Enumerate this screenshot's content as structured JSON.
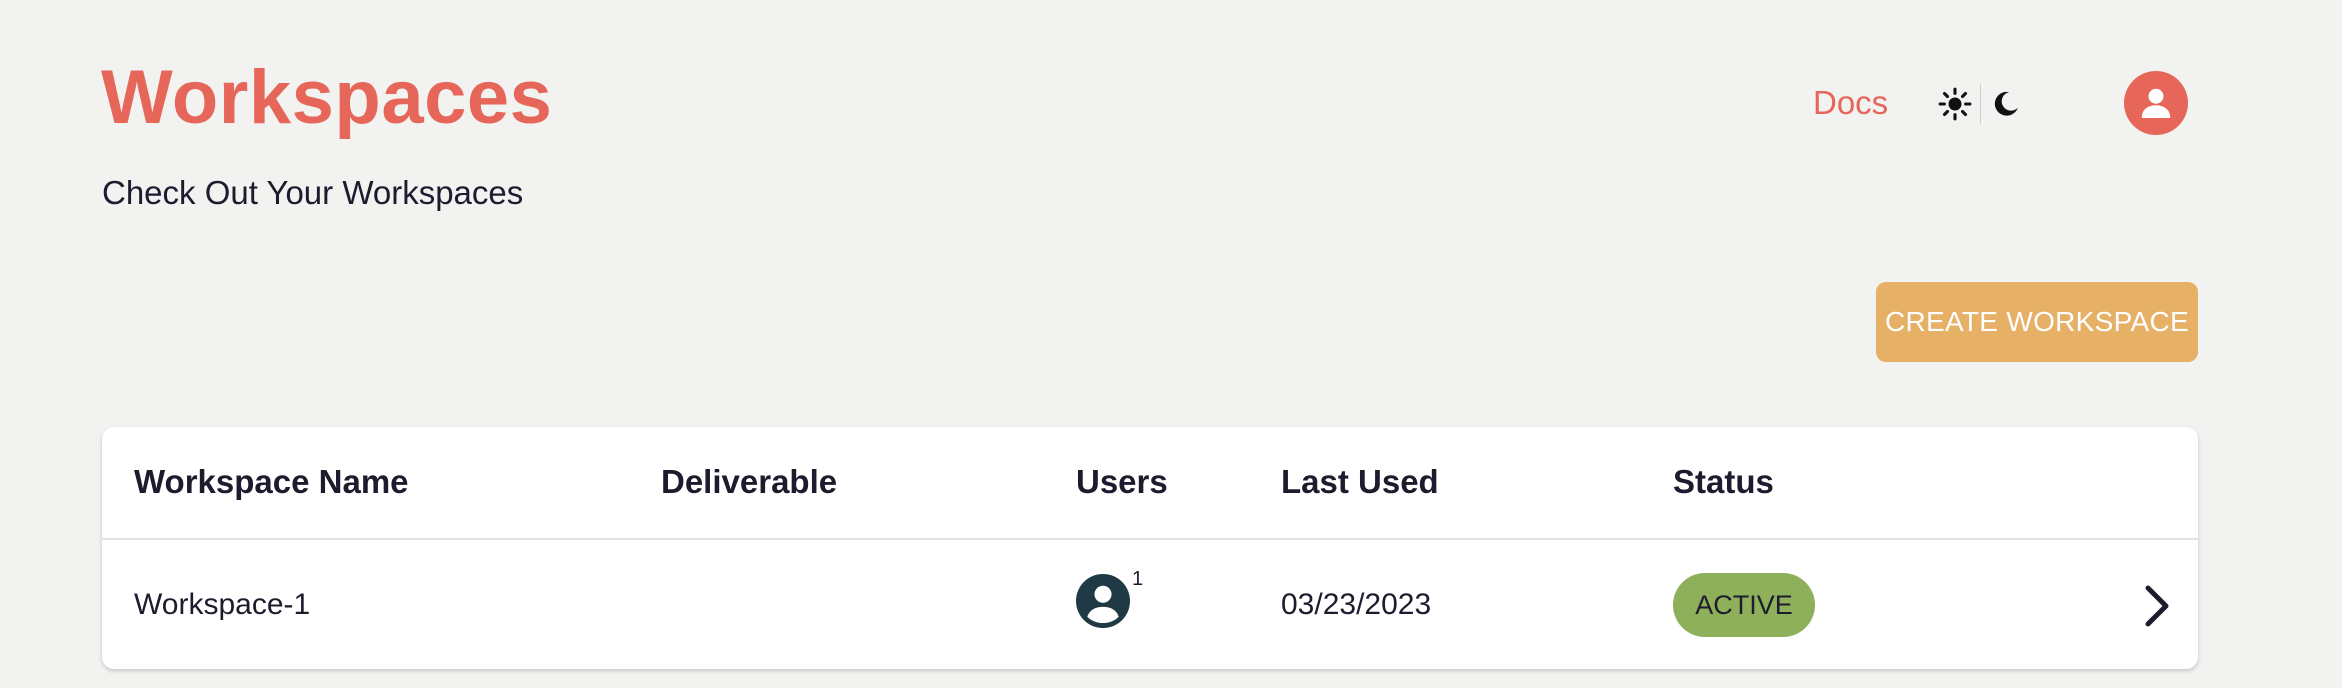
{
  "header": {
    "title": "Workspaces",
    "subtitle": "Check Out Your Workspaces",
    "docs_label": "Docs"
  },
  "icons": {
    "light_theme": "sun-icon",
    "dark_theme": "moon-icon",
    "profile": "user-icon",
    "row_open": "chevron-right-icon",
    "users": "user-circle-icon"
  },
  "actions": {
    "create_label": "CREATE WORKSPACE"
  },
  "table": {
    "columns": [
      "Workspace Name",
      "Deliverable",
      "Users",
      "Last Used",
      "Status"
    ],
    "rows": [
      {
        "name": "Workspace-1",
        "deliverable": "",
        "users": "1",
        "last_used": "03/23/2023",
        "status": "ACTIVE"
      }
    ]
  },
  "colors": {
    "accent": "#e6665a",
    "button": "#e6b167",
    "status_active": "#8fb05a",
    "background": "#f2f2f0"
  }
}
